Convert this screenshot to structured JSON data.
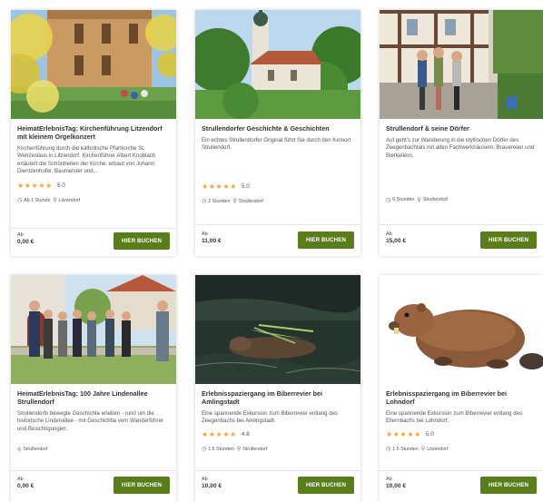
{
  "cards": [
    {
      "title": "HeimatErlebnisTag: Kirchenführung Litzendorf mit kleinem Orgelkonzert",
      "desc": "Kirchenführung durch die katholische Pfarrkirche St. Wenzeslaus in Litzendorf. Kirchenführer Albert Knoblach erläutert die Schönheiten der Kirche, erbaut von Johann Dientzenhofer, Baumeister und...",
      "stars": "★★★★★",
      "rating": "5.0",
      "duration": "Ab 1 Stunde",
      "location": "Litzendorf",
      "price_label": "Ab",
      "price": "0,00 €",
      "button": "HIER BUCHEN"
    },
    {
      "title": "Strullendorfer Geschichte & Geschichten",
      "desc": "Ein echtes Strullendorfer Original führt Sie durch den Kernort Strullendorf.",
      "stars": "★★★★★",
      "rating": "5.0",
      "duration": "2 Stunden",
      "location": "Strullendorf",
      "price_label": "Ab",
      "price": "11,00 €",
      "button": "HIER BUCHEN"
    },
    {
      "title": "Strullendorf & seine Dörfer",
      "desc": "Auf geht's zur Wanderung in die idyllischen Dörfer des Zeegenbachtals mit alten Fachwerkhäusern, Brauereien und Bierkellern.",
      "duration": "6 Stunden",
      "location": "Strullendorf",
      "price_label": "Ab",
      "price": "15,00 €",
      "button": "HIER BUCHEN"
    },
    {
      "title": "HeimatErlebnisTag: 100 Jahre Lindenallee Strullendorf",
      "desc": "Strullendorfs bewegte Geschichte erleben - rund um die historische Lindenallee - mit Geschichtla vom Wanderführer und Besichtigungen.",
      "location": "Strullendorf",
      "price_label": "Ab",
      "price": "0,00 €",
      "button": "HIER BUCHEN"
    },
    {
      "title": "Erlebnisspaziergang im Biberrevier bei Amlingstadt",
      "desc": "Eine spannende Exkursion zum Biberrevier entlang des Zeegenbachs bei Amlingstadt.",
      "stars": "★★★★★",
      "rating": "4.8",
      "duration": "1.5 Stunden",
      "location": "Strullendorf",
      "price_label": "Ab",
      "price": "10,00 €",
      "button": "HIER BUCHEN"
    },
    {
      "title": "Erlebnisspaziergang im Biberrevier bei Lohndorf",
      "desc": "Eine spannende Exkursion zum Biberrevier entlang des Ellernbachs bei Lohndorf.",
      "stars": "★★★★★",
      "rating": "5.0",
      "duration": "1.5 Stunden",
      "location": "Litzendorf",
      "price_label": "Ab",
      "price": "10,00 €",
      "button": "HIER BUCHEN"
    }
  ],
  "colors": {
    "button": "#5a7d1c",
    "stars": "#f0a43a"
  },
  "icons": {
    "clock": "clock-icon",
    "pin": "location-pin-icon"
  }
}
